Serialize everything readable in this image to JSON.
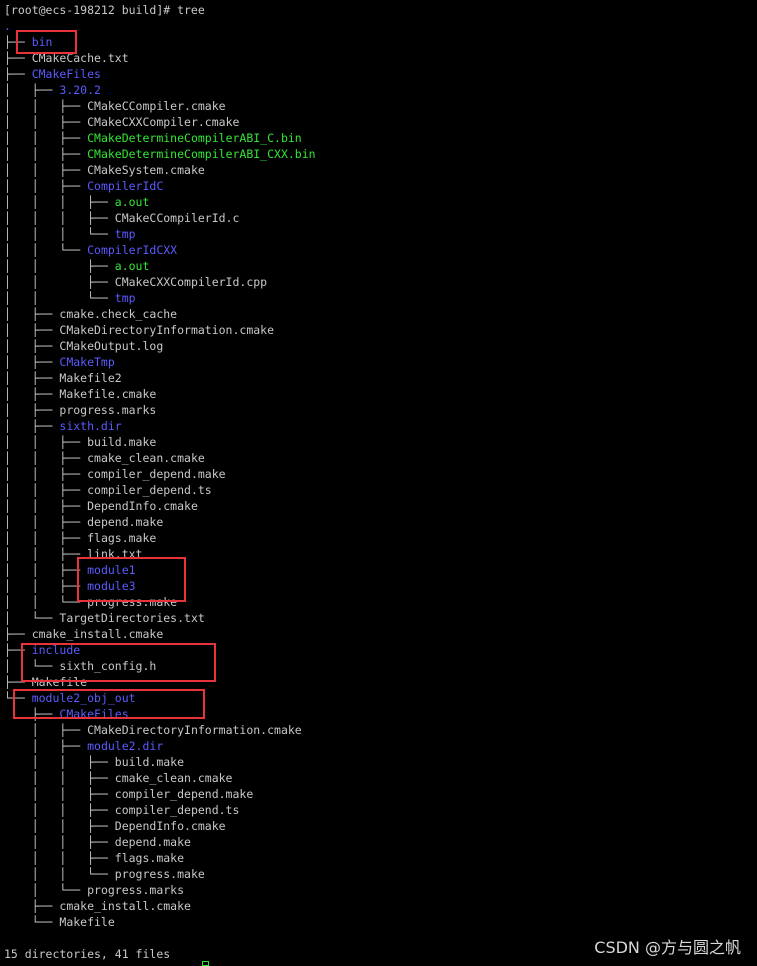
{
  "prompt": "[root@ecs-198212 build]# tree",
  "lines": [
    {
      "prefix": "",
      "name": ".",
      "kind": "dir"
    },
    {
      "prefix": "├── ",
      "name": "bin",
      "kind": "dir"
    },
    {
      "prefix": "├── ",
      "name": "CMakeCache.txt",
      "kind": "file"
    },
    {
      "prefix": "├── ",
      "name": "CMakeFiles",
      "kind": "dir"
    },
    {
      "prefix": "│   ├── ",
      "name": "3.20.2",
      "kind": "dir"
    },
    {
      "prefix": "│   │   ├── ",
      "name": "CMakeCCompiler.cmake",
      "kind": "file"
    },
    {
      "prefix": "│   │   ├── ",
      "name": "CMakeCXXCompiler.cmake",
      "kind": "file"
    },
    {
      "prefix": "│   │   ├── ",
      "name": "CMakeDetermineCompilerABI_C.bin",
      "kind": "exe"
    },
    {
      "prefix": "│   │   ├── ",
      "name": "CMakeDetermineCompilerABI_CXX.bin",
      "kind": "exe"
    },
    {
      "prefix": "│   │   ├── ",
      "name": "CMakeSystem.cmake",
      "kind": "file"
    },
    {
      "prefix": "│   │   ├── ",
      "name": "CompilerIdC",
      "kind": "dir"
    },
    {
      "prefix": "│   │   │   ├── ",
      "name": "a.out",
      "kind": "exe"
    },
    {
      "prefix": "│   │   │   ├── ",
      "name": "CMakeCCompilerId.c",
      "kind": "file"
    },
    {
      "prefix": "│   │   │   └── ",
      "name": "tmp",
      "kind": "dir"
    },
    {
      "prefix": "│   │   └── ",
      "name": "CompilerIdCXX",
      "kind": "dir"
    },
    {
      "prefix": "│   │       ├── ",
      "name": "a.out",
      "kind": "exe"
    },
    {
      "prefix": "│   │       ├── ",
      "name": "CMakeCXXCompilerId.cpp",
      "kind": "file"
    },
    {
      "prefix": "│   │       └── ",
      "name": "tmp",
      "kind": "dir"
    },
    {
      "prefix": "│   ├── ",
      "name": "cmake.check_cache",
      "kind": "file"
    },
    {
      "prefix": "│   ├── ",
      "name": "CMakeDirectoryInformation.cmake",
      "kind": "file"
    },
    {
      "prefix": "│   ├── ",
      "name": "CMakeOutput.log",
      "kind": "file"
    },
    {
      "prefix": "│   ├── ",
      "name": "CMakeTmp",
      "kind": "dir"
    },
    {
      "prefix": "│   ├── ",
      "name": "Makefile2",
      "kind": "file"
    },
    {
      "prefix": "│   ├── ",
      "name": "Makefile.cmake",
      "kind": "file"
    },
    {
      "prefix": "│   ├── ",
      "name": "progress.marks",
      "kind": "file"
    },
    {
      "prefix": "│   ├── ",
      "name": "sixth.dir",
      "kind": "dir"
    },
    {
      "prefix": "│   │   ├── ",
      "name": "build.make",
      "kind": "file"
    },
    {
      "prefix": "│   │   ├── ",
      "name": "cmake_clean.cmake",
      "kind": "file"
    },
    {
      "prefix": "│   │   ├── ",
      "name": "compiler_depend.make",
      "kind": "file"
    },
    {
      "prefix": "│   │   ├── ",
      "name": "compiler_depend.ts",
      "kind": "file"
    },
    {
      "prefix": "│   │   ├── ",
      "name": "DependInfo.cmake",
      "kind": "file"
    },
    {
      "prefix": "│   │   ├── ",
      "name": "depend.make",
      "kind": "file"
    },
    {
      "prefix": "│   │   ├── ",
      "name": "flags.make",
      "kind": "file"
    },
    {
      "prefix": "│   │   ├── ",
      "name": "link.txt",
      "kind": "file"
    },
    {
      "prefix": "│   │   ├── ",
      "name": "module1",
      "kind": "dir"
    },
    {
      "prefix": "│   │   ├── ",
      "name": "module3",
      "kind": "dir"
    },
    {
      "prefix": "│   │   └── ",
      "name": "progress.make",
      "kind": "file"
    },
    {
      "prefix": "│   └── ",
      "name": "TargetDirectories.txt",
      "kind": "file"
    },
    {
      "prefix": "├── ",
      "name": "cmake_install.cmake",
      "kind": "file"
    },
    {
      "prefix": "├── ",
      "name": "include",
      "kind": "dir"
    },
    {
      "prefix": "│   └── ",
      "name": "sixth_config.h",
      "kind": "file"
    },
    {
      "prefix": "├── ",
      "name": "Makefile",
      "kind": "file"
    },
    {
      "prefix": "└── ",
      "name": "module2_obj_out",
      "kind": "dir"
    },
    {
      "prefix": "    ├── ",
      "name": "CMakeFiles",
      "kind": "dir"
    },
    {
      "prefix": "    │   ├── ",
      "name": "CMakeDirectoryInformation.cmake",
      "kind": "file"
    },
    {
      "prefix": "    │   ├── ",
      "name": "module2.dir",
      "kind": "dir"
    },
    {
      "prefix": "    │   │   ├── ",
      "name": "build.make",
      "kind": "file"
    },
    {
      "prefix": "    │   │   ├── ",
      "name": "cmake_clean.cmake",
      "kind": "file"
    },
    {
      "prefix": "    │   │   ├── ",
      "name": "compiler_depend.make",
      "kind": "file"
    },
    {
      "prefix": "    │   │   ├── ",
      "name": "compiler_depend.ts",
      "kind": "file"
    },
    {
      "prefix": "    │   │   ├── ",
      "name": "DependInfo.cmake",
      "kind": "file"
    },
    {
      "prefix": "    │   │   ├── ",
      "name": "depend.make",
      "kind": "file"
    },
    {
      "prefix": "    │   │   ├── ",
      "name": "flags.make",
      "kind": "file"
    },
    {
      "prefix": "    │   │   └── ",
      "name": "progress.make",
      "kind": "file"
    },
    {
      "prefix": "    │   └── ",
      "name": "progress.marks",
      "kind": "file"
    },
    {
      "prefix": "    ├── ",
      "name": "cmake_install.cmake",
      "kind": "file"
    },
    {
      "prefix": "    └── ",
      "name": "Makefile",
      "kind": "file"
    }
  ],
  "summary": "15 directories, 41 files",
  "watermark": "CSDN @方与圆之帆",
  "colors": {
    "background": "#000000",
    "text": "#c8c8c8",
    "directory": "#5b5bff",
    "executable": "#33e533",
    "highlight_box": "#e8333a"
  }
}
